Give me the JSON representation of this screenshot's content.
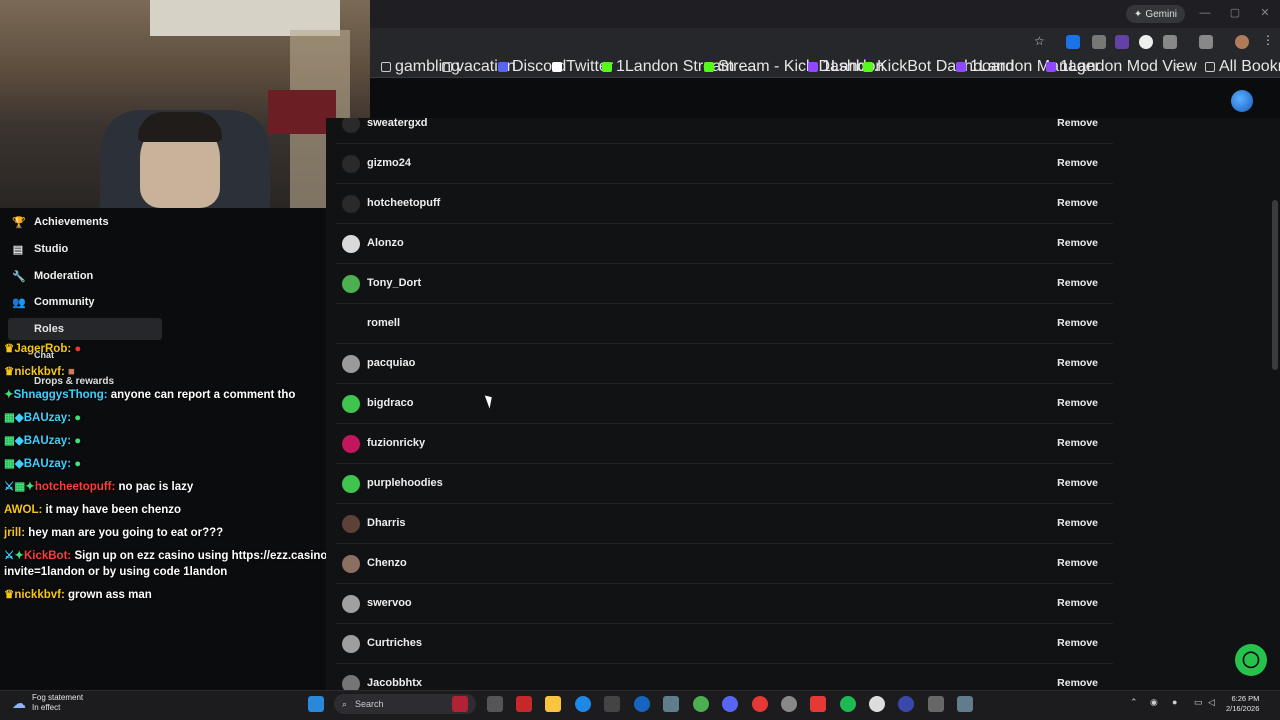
{
  "browser": {
    "gemini_label": "Gemini",
    "bookmarks": [
      {
        "label": "gambling",
        "color": "#888888"
      },
      {
        "label": "vacation",
        "color": "#888888"
      },
      {
        "label": "Discord",
        "color": "#5865f2"
      },
      {
        "label": "Twitter",
        "color": "#ffffff"
      },
      {
        "label": "1Landon Stream -...",
        "color": "#53fc18"
      },
      {
        "label": "Stream - Kick Dashb...",
        "color": "#53fc18"
      },
      {
        "label": "1Landon",
        "color": "#9146ff"
      },
      {
        "label": "KickBot Dashboard",
        "color": "#53fc18"
      },
      {
        "label": "1Landon Manager",
        "color": "#9146ff"
      },
      {
        "label": "1Landon Mod View",
        "color": "#9146ff"
      }
    ],
    "all_bookmarks": "All Bookmarks"
  },
  "sidebar": {
    "items": [
      {
        "label": "Achievements",
        "icon": "trophy-icon",
        "glyph": "🏆"
      },
      {
        "label": "Studio",
        "icon": "studio-icon",
        "glyph": "▤"
      },
      {
        "label": "Moderation",
        "icon": "wrench-icon",
        "glyph": "🔧"
      },
      {
        "label": "Community",
        "icon": "users-icon",
        "glyph": "👥"
      }
    ],
    "sub_items": [
      {
        "label": "Roles"
      },
      {
        "label": "Chat"
      },
      {
        "label": "Drops & rewards"
      }
    ]
  },
  "chat": [
    {
      "user": "JagerRob:",
      "user_color": "#f5c518",
      "text": ""
    },
    {
      "user": "nickkbvf:",
      "user_color": "#f5c518",
      "text": ""
    },
    {
      "user": "ShnaggysThong:",
      "user_color": "#3fd0ff",
      "text": "anyone can report a comment tho"
    },
    {
      "user": "BAUzay:",
      "user_color": "#3fd0ff",
      "text": ""
    },
    {
      "user": "BAUzay:",
      "user_color": "#3fd0ff",
      "text": ""
    },
    {
      "user": "BAUzay:",
      "user_color": "#3fd0ff",
      "text": ""
    },
    {
      "user": "hotcheetopuff:",
      "user_color": "#ff3b3b",
      "text": "no pac is lazy"
    },
    {
      "user": "AWOL:",
      "user_color": "#f5c518",
      "text": "it may have been chenzo"
    },
    {
      "user": "jrill:",
      "user_color": "#f5c518",
      "text": "hey man are you going to eat or???"
    },
    {
      "user": "KickBot:",
      "user_color": "#ff3b3b",
      "text": "Sign up on ezz casino using https://ezz.casino/?"
    },
    {
      "user": "",
      "user_color": "#ffffff",
      "text": "invite=1landon or by using code 1landon"
    },
    {
      "user": "nickkbvf:",
      "user_color": "#f5c518",
      "text": "grown ass man"
    }
  ],
  "members": [
    {
      "name": "sweatergxd",
      "avatar_color": "#2a2a2a"
    },
    {
      "name": "gizmo24",
      "avatar_color": "#2a2a2a"
    },
    {
      "name": "hotcheetopuff",
      "avatar_color": "#2a2a2a"
    },
    {
      "name": "Alonzo",
      "avatar_color": "#d9d9d9"
    },
    {
      "name": "Tony_Dort",
      "avatar_color": "#4caf50"
    },
    {
      "name": "romell",
      "avatar_color": "#111214"
    },
    {
      "name": "pacquiao",
      "avatar_color": "#9a9a9a"
    },
    {
      "name": "bigdraco",
      "avatar_color": "#3ec44f"
    },
    {
      "name": "fuzionricky",
      "avatar_color": "#c2185b"
    },
    {
      "name": "purplehoodies",
      "avatar_color": "#3ec44f"
    },
    {
      "name": "Dharris",
      "avatar_color": "#5d4037"
    },
    {
      "name": "Chenzo",
      "avatar_color": "#8d6e63"
    },
    {
      "name": "swervoo",
      "avatar_color": "#a0a0a0"
    },
    {
      "name": "Curtriches",
      "avatar_color": "#9e9e9e"
    },
    {
      "name": "Jacobbhtx",
      "avatar_color": "#757575"
    }
  ],
  "remove_label": "Remove",
  "taskbar": {
    "weather_line1": "Fog statement",
    "weather_line2": "In effect",
    "search_label": "Search",
    "time": "6:26 PM",
    "date": "2/16/2026"
  }
}
